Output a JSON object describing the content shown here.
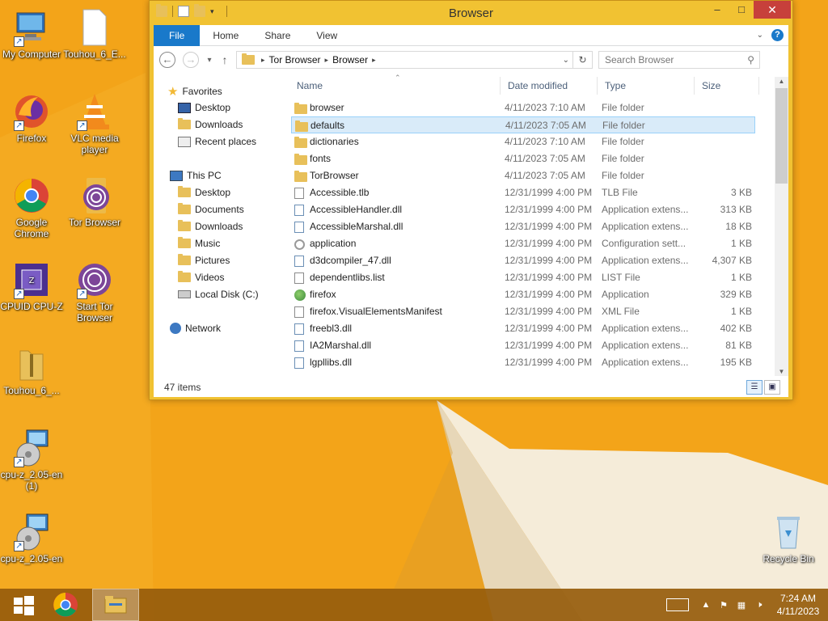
{
  "window": {
    "title": "Browser",
    "controls": {
      "minimize": "–",
      "maximize": "□",
      "close": "✕"
    }
  },
  "ribbon": {
    "tabs": [
      "File",
      "Home",
      "Share",
      "View"
    ],
    "help": "?"
  },
  "address": {
    "crumbs": [
      "Tor Browser",
      "Browser"
    ],
    "search_placeholder": "Search Browser"
  },
  "navpane": {
    "favorites": {
      "label": "Favorites",
      "items": [
        "Desktop",
        "Downloads",
        "Recent places"
      ]
    },
    "this_pc": {
      "label": "This PC",
      "items": [
        "Desktop",
        "Documents",
        "Downloads",
        "Music",
        "Pictures",
        "Videos",
        "Local Disk (C:)"
      ]
    },
    "network": {
      "label": "Network"
    }
  },
  "columns": {
    "name": "Name",
    "date": "Date modified",
    "type": "Type",
    "size": "Size"
  },
  "files": [
    {
      "name": "browser",
      "date": "4/11/2023 7:10 AM",
      "type": "File folder",
      "size": "",
      "kind": "folder"
    },
    {
      "name": "defaults",
      "date": "4/11/2023 7:05 AM",
      "type": "File folder",
      "size": "",
      "kind": "folder",
      "selected": true
    },
    {
      "name": "dictionaries",
      "date": "4/11/2023 7:10 AM",
      "type": "File folder",
      "size": "",
      "kind": "folder"
    },
    {
      "name": "fonts",
      "date": "4/11/2023 7:05 AM",
      "type": "File folder",
      "size": "",
      "kind": "folder"
    },
    {
      "name": "TorBrowser",
      "date": "4/11/2023 7:05 AM",
      "type": "File folder",
      "size": "",
      "kind": "folder"
    },
    {
      "name": "Accessible.tlb",
      "date": "12/31/1999 4:00 PM",
      "type": "TLB File",
      "size": "3 KB",
      "kind": "file"
    },
    {
      "name": "AccessibleHandler.dll",
      "date": "12/31/1999 4:00 PM",
      "type": "Application extens...",
      "size": "313 KB",
      "kind": "dll"
    },
    {
      "name": "AccessibleMarshal.dll",
      "date": "12/31/1999 4:00 PM",
      "type": "Application extens...",
      "size": "18 KB",
      "kind": "dll"
    },
    {
      "name": "application",
      "date": "12/31/1999 4:00 PM",
      "type": "Configuration sett...",
      "size": "1 KB",
      "kind": "config"
    },
    {
      "name": "d3dcompiler_47.dll",
      "date": "12/31/1999 4:00 PM",
      "type": "Application extens...",
      "size": "4,307 KB",
      "kind": "dll"
    },
    {
      "name": "dependentlibs.list",
      "date": "12/31/1999 4:00 PM",
      "type": "LIST File",
      "size": "1 KB",
      "kind": "file"
    },
    {
      "name": "firefox",
      "date": "12/31/1999 4:00 PM",
      "type": "Application",
      "size": "329 KB",
      "kind": "app"
    },
    {
      "name": "firefox.VisualElementsManifest",
      "date": "12/31/1999 4:00 PM",
      "type": "XML File",
      "size": "1 KB",
      "kind": "file"
    },
    {
      "name": "freebl3.dll",
      "date": "12/31/1999 4:00 PM",
      "type": "Application extens...",
      "size": "402 KB",
      "kind": "dll"
    },
    {
      "name": "IA2Marshal.dll",
      "date": "12/31/1999 4:00 PM",
      "type": "Application extens...",
      "size": "81 KB",
      "kind": "dll"
    },
    {
      "name": "lgpllibs.dll",
      "date": "12/31/1999 4:00 PM",
      "type": "Application extens...",
      "size": "195 KB",
      "kind": "dll"
    }
  ],
  "status": {
    "items": "47 items"
  },
  "desktop_icons": [
    {
      "label": "My Computer",
      "icon": "computer-icon"
    },
    {
      "label": "Touhou_6_E...",
      "icon": "blank-file-icon"
    },
    {
      "label": "Firefox",
      "icon": "firefox-icon"
    },
    {
      "label": "VLC media player",
      "icon": "vlc-icon"
    },
    {
      "label": "Google Chrome",
      "icon": "chrome-icon"
    },
    {
      "label": "Tor Browser",
      "icon": "tor-icon"
    },
    {
      "label": "CPUID CPU-Z",
      "icon": "cpuz-icon"
    },
    {
      "label": "Start Tor Browser",
      "icon": "tor-icon"
    },
    {
      "label": "Touhou_6_...",
      "icon": "zip-folder-icon"
    },
    {
      "label": "cpu-z_2.05-en (1)",
      "icon": "installer-icon"
    },
    {
      "label": "cpu-z_2.05-en",
      "icon": "installer-icon"
    },
    {
      "label": "Recycle Bin",
      "icon": "recycle-bin-icon"
    }
  ],
  "taskbar": {
    "clock_time": "7:24 AM",
    "clock_date": "4/11/2023"
  },
  "colors": {
    "wallpaper": "#f3a419",
    "accent": "#1979ca",
    "selection": "#d9ebf9"
  }
}
